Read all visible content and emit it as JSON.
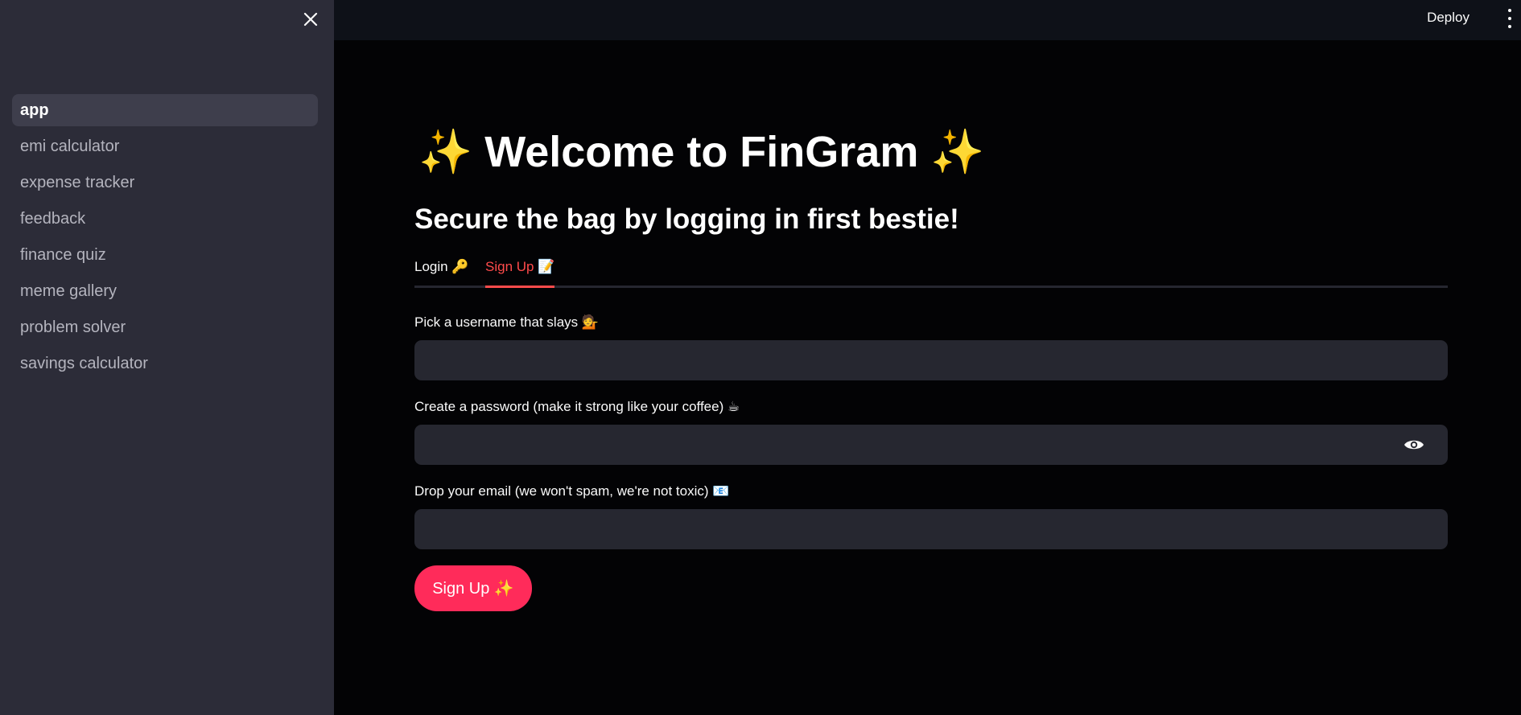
{
  "sidebar": {
    "close_icon": "close-icon",
    "items": [
      {
        "label": "app",
        "active": true
      },
      {
        "label": "emi calculator",
        "active": false
      },
      {
        "label": "expense tracker",
        "active": false
      },
      {
        "label": "feedback",
        "active": false
      },
      {
        "label": "finance quiz",
        "active": false
      },
      {
        "label": "meme gallery",
        "active": false
      },
      {
        "label": "problem solver",
        "active": false
      },
      {
        "label": "savings calculator",
        "active": false
      }
    ]
  },
  "header": {
    "deploy_label": "Deploy",
    "menu_icon": "kebab-menu-icon"
  },
  "main": {
    "title": "✨ Welcome to FinGram ✨",
    "subtitle": "Secure the bag by logging in first bestie!",
    "tabs": [
      {
        "label": "Login 🔑",
        "active": false
      },
      {
        "label": "Sign Up 📝",
        "active": true
      }
    ],
    "form": {
      "username_label": "Pick a username that slays 💁",
      "username_value": "",
      "password_label": "Create a password (make it strong like your coffee) ☕",
      "password_value": "",
      "password_toggle_icon": "eye-icon",
      "email_label": "Drop your email (we won't spam, we're not toxic) 📧",
      "email_value": "",
      "submit_label": "Sign Up ✨"
    }
  },
  "colors": {
    "accent": "#ff4b4b",
    "button": "#ff2b5a",
    "sidebar_bg": "#2c2c38",
    "main_bg": "#030305",
    "input_bg": "#262730"
  }
}
